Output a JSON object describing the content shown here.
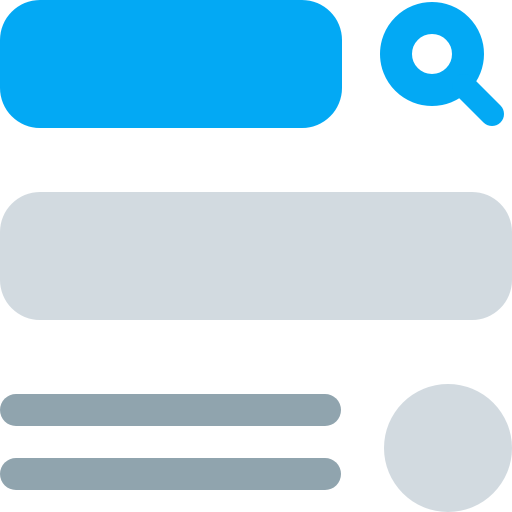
{
  "colors": {
    "search_bar": "#03A9F4",
    "search_icon": "#03A9F4",
    "content_block": "#D2DAE0",
    "text_lines": "#90A4AE",
    "avatar": "#D2DAE0"
  },
  "icons": {
    "search": "search-icon"
  }
}
